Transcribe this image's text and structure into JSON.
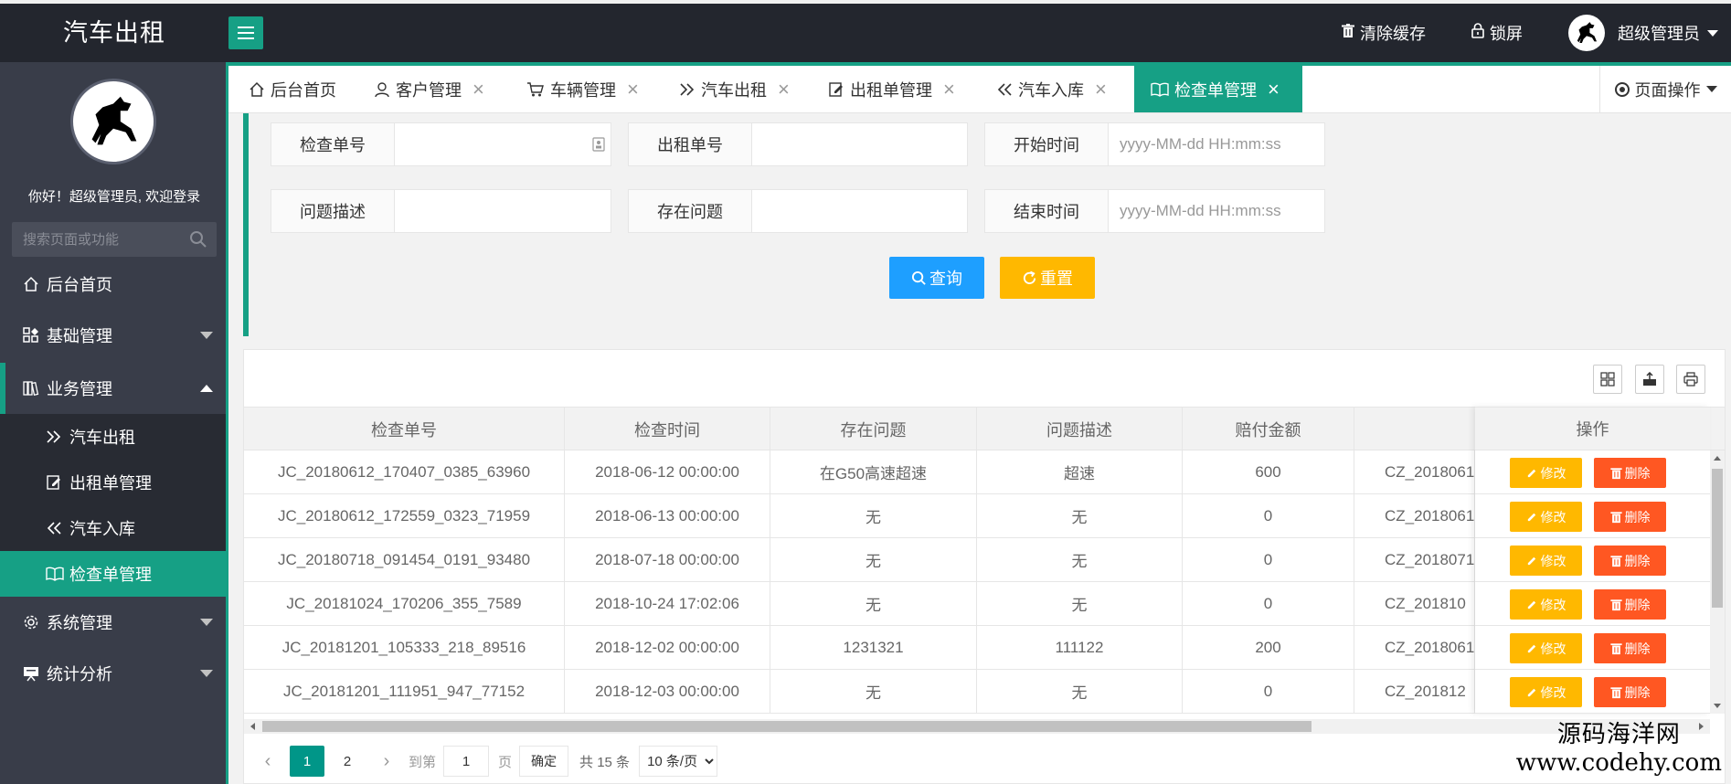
{
  "app": {
    "title": "汽车出租"
  },
  "header": {
    "clear_cache": "清除缓存",
    "lock_screen": "锁屏",
    "user_name": "超级管理员"
  },
  "sidebar": {
    "welcome": "你好！超级管理员, 欢迎登录",
    "search_placeholder": "搜索页面或功能",
    "items": [
      {
        "label": "后台首页"
      },
      {
        "label": "基础管理"
      },
      {
        "label": "业务管理"
      },
      {
        "label": "系统管理"
      },
      {
        "label": "统计分析"
      }
    ],
    "sub_items": [
      {
        "label": "汽车出租"
      },
      {
        "label": "出租单管理"
      },
      {
        "label": "汽车入库"
      },
      {
        "label": "检查单管理"
      }
    ]
  },
  "tabs": [
    {
      "label": "后台首页"
    },
    {
      "label": "客户管理"
    },
    {
      "label": "车辆管理"
    },
    {
      "label": "汽车出租"
    },
    {
      "label": "出租单管理"
    },
    {
      "label": "汽车入库"
    },
    {
      "label": "检查单管理"
    }
  ],
  "page_ops": "页面操作",
  "filter": {
    "check_no_label": "检查单号",
    "rent_no_label": "出租单号",
    "start_time_label": "开始时间",
    "desc_label": "问题描述",
    "problem_label": "存在问题",
    "end_time_label": "结束时间",
    "time_placeholder": "yyyy-MM-dd HH:mm:ss",
    "query_label": "查询",
    "reset_label": "重置"
  },
  "table": {
    "headers": [
      "检查单号",
      "检查时间",
      "存在问题",
      "问题描述",
      "赔付金额",
      "操作"
    ],
    "rows": [
      {
        "check_no": "JC_20180612_170407_0385_63960",
        "time": "2018-06-12 00:00:00",
        "problem": "在G50高速超速",
        "desc": "超速",
        "amount": "600",
        "rent_no": "CZ_2018061"
      },
      {
        "check_no": "JC_20180612_172559_0323_71959",
        "time": "2018-06-13 00:00:00",
        "problem": "无",
        "desc": "无",
        "amount": "0",
        "rent_no": "CZ_2018061"
      },
      {
        "check_no": "JC_20180718_091454_0191_93480",
        "time": "2018-07-18 00:00:00",
        "problem": "无",
        "desc": "无",
        "amount": "0",
        "rent_no": "CZ_2018071"
      },
      {
        "check_no": "JC_20181024_170206_355_7589",
        "time": "2018-10-24 17:02:06",
        "problem": "无",
        "desc": "无",
        "amount": "0",
        "rent_no": "CZ_201810"
      },
      {
        "check_no": "JC_20181201_105333_218_89516",
        "time": "2018-12-02 00:00:00",
        "problem": "1231321",
        "desc": "111122",
        "amount": "200",
        "rent_no": "CZ_2018061"
      },
      {
        "check_no": "JC_20181201_111951_947_77152",
        "time": "2018-12-03 00:00:00",
        "problem": "无",
        "desc": "无",
        "amount": "0",
        "rent_no": "CZ_201812"
      }
    ],
    "edit_label": "修改",
    "delete_label": "删除"
  },
  "pager": {
    "pages": [
      "1",
      "2"
    ],
    "goto_label": "到第",
    "page_value": "1",
    "page_unit": "页",
    "confirm_label": "确定",
    "total_label": "共 15 条",
    "page_size": "10 条/页"
  },
  "watermark": {
    "line1": "源码海洋网",
    "line2": "www.codehy.com"
  }
}
